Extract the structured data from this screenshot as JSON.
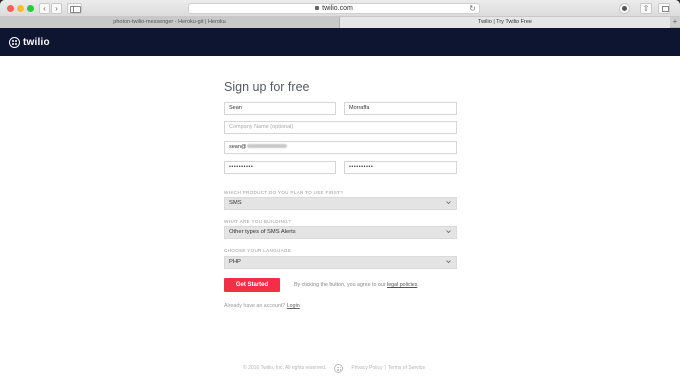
{
  "browser": {
    "url": "twilio.com",
    "tabs": [
      {
        "label": "photon-twilio-messenger - Heroku-git | Heroku"
      },
      {
        "label": "Twilio | Try Twilio Free"
      }
    ],
    "new_tab": "+"
  },
  "header": {
    "logo_text": "twilio"
  },
  "form": {
    "title": "Sign up for free",
    "first_name": "Sean",
    "last_name": "Morraffa",
    "company_placeholder": "Company Name (optional)",
    "email_prefix": "sean@",
    "password_mask": "••••••••••",
    "password_confirm_mask": "••••••••••",
    "product_label": "WHICH PRODUCT DO YOU PLAN TO USE FIRST?",
    "product_value": "SMS",
    "building_label": "WHAT ARE YOU BUILDING?",
    "building_value": "Other types of SMS Alerts",
    "language_label": "CHOOSE YOUR LANGUAGE",
    "language_value": "PHP",
    "submit_label": "Get Started",
    "agree_text": "By clicking the button, you agree to our ",
    "agree_link": "legal policies",
    "agree_end": ".",
    "login_text": "Already have an account? ",
    "login_link": "Login"
  },
  "footer": {
    "copyright": "© 2016 Twilio, Inc. All rights reserved.",
    "privacy": "Privacy Policy",
    "separator": "|",
    "terms": "Terms of Service"
  },
  "colors": {
    "header_bg": "#0d1531",
    "accent": "#f22f46"
  }
}
